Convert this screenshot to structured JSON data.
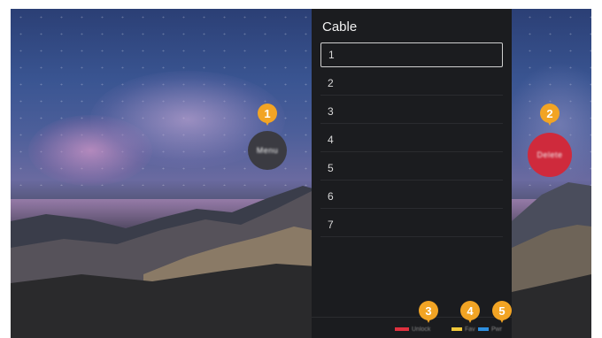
{
  "panel": {
    "title": "Cable",
    "channels": [
      "1",
      "2",
      "3",
      "4",
      "5",
      "6",
      "7"
    ]
  },
  "bubbles": {
    "left_label": "Menu",
    "right_label": "Delete"
  },
  "markers": [
    "1",
    "2",
    "3",
    "4",
    "5"
  ],
  "legend": [
    {
      "label": "Unlock",
      "color": "#e0313f"
    },
    {
      "label": "Fav",
      "color": "#f1c83a"
    },
    {
      "label": "Pwr",
      "color": "#2e8fe0"
    }
  ],
  "colors": {
    "marker": "#f2a424",
    "panel_bg": "#1b1c1f",
    "delete_bubble": "#cf2a3c",
    "menu_bubble": "#3b3b42"
  }
}
